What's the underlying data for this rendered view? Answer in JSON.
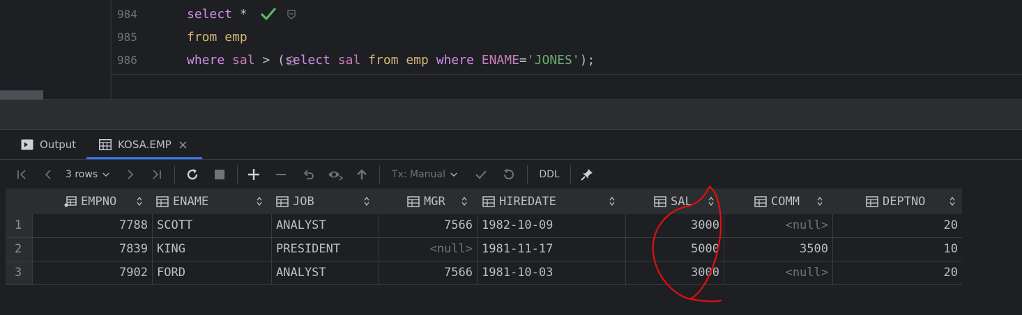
{
  "editor": {
    "lines": [
      {
        "number": "984",
        "tokens": [
          {
            "t": "select",
            "c": "kw"
          },
          {
            "t": " *",
            "c": ""
          }
        ]
      },
      {
        "number": "985",
        "tokens": [
          {
            "t": "from",
            "c": "kwcol"
          },
          {
            "t": " ",
            "c": ""
          },
          {
            "t": "emp",
            "c": "kwcol"
          }
        ]
      },
      {
        "number": "986",
        "tokens": [
          {
            "t": "where",
            "c": "kw"
          },
          {
            "t": " ",
            "c": ""
          },
          {
            "t": "sal",
            "c": "col"
          },
          {
            "t": " > (",
            "c": ""
          },
          {
            "t": "select",
            "c": "kw"
          },
          {
            "t": " ",
            "c": ""
          },
          {
            "t": "sal",
            "c": "col"
          },
          {
            "t": " ",
            "c": ""
          },
          {
            "t": "from",
            "c": "kwcol"
          },
          {
            "t": " ",
            "c": ""
          },
          {
            "t": "emp",
            "c": "kwcol"
          },
          {
            "t": " ",
            "c": ""
          },
          {
            "t": "where",
            "c": "kw"
          },
          {
            "t": " ",
            "c": ""
          },
          {
            "t": "ENAME",
            "c": "col"
          },
          {
            "t": "=",
            "c": ""
          },
          {
            "t": "'JONES'",
            "c": "str"
          },
          {
            "t": ");",
            "c": ""
          }
        ]
      }
    ]
  },
  "tabs": {
    "output": "Output",
    "kosa": "KOSA.EMP",
    "close": "×"
  },
  "toolbar": {
    "rows": "3 rows",
    "tx": "Tx: Manual",
    "ddl": "DDL"
  },
  "grid": {
    "columns": [
      "EMPNO",
      "ENAME",
      "JOB",
      "MGR",
      "HIREDATE",
      "SAL",
      "COMM",
      "DEPTNO"
    ],
    "rows": [
      {
        "n": "1",
        "EMPNO": "7788",
        "ENAME": "SCOTT",
        "JOB": "ANALYST",
        "MGR": "7566",
        "HIREDATE": "1982-10-09",
        "SAL": "3000",
        "COMM": "<null>",
        "DEPTNO": "20"
      },
      {
        "n": "2",
        "EMPNO": "7839",
        "ENAME": "KING",
        "JOB": "PRESIDENT",
        "MGR": "<null>",
        "HIREDATE": "1981-11-17",
        "SAL": "5000",
        "COMM": "3500",
        "DEPTNO": "10"
      },
      {
        "n": "3",
        "EMPNO": "7902",
        "ENAME": "FORD",
        "JOB": "ANALYST",
        "MGR": "7566",
        "HIREDATE": "1981-10-03",
        "SAL": "3000",
        "COMM": "<null>",
        "DEPTNO": "20"
      }
    ]
  },
  "colors": {
    "keyword": "#cf8ee8",
    "identifier": "#c77dbb",
    "string": "#6aab73",
    "accent": "#3574f0",
    "annotation": "#e01010"
  }
}
